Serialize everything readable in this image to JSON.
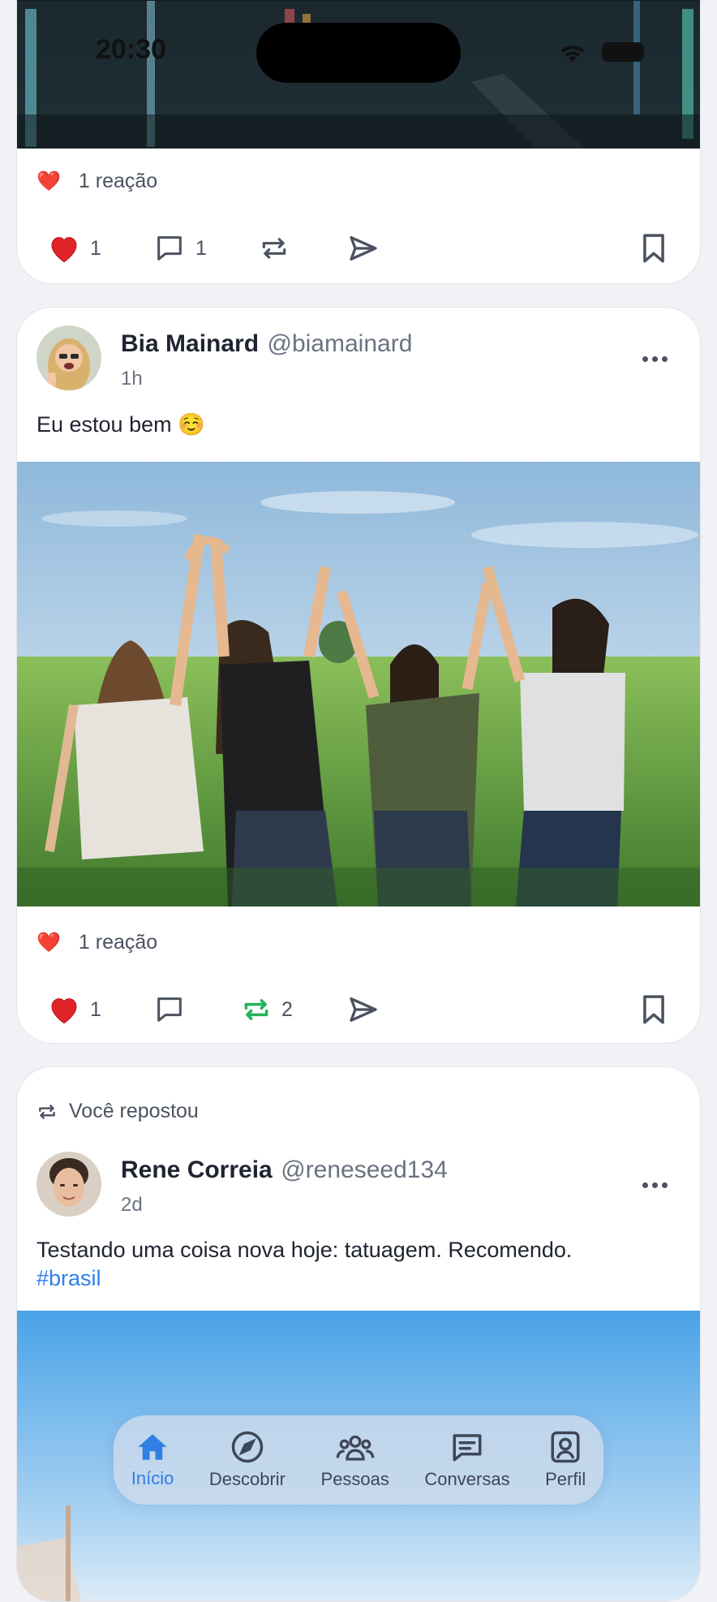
{
  "status_bar": {
    "time": "20:30"
  },
  "posts": [
    {
      "reaction_emoji": "❤️",
      "reaction_summary": "1 reação",
      "likes": "1",
      "comments": "1",
      "reposts": "",
      "reposted_active": false
    },
    {
      "author_name": "Bia Mainard",
      "author_handle": "@biamainard",
      "time": "1h",
      "text": "Eu estou bem ☺️",
      "reaction_emoji": "❤️",
      "reaction_summary": "1 reação",
      "likes": "1",
      "comments": "",
      "reposts": "2",
      "reposted_active": true
    },
    {
      "repost_label": "Você repostou",
      "author_name": "Rene Correia",
      "author_handle": "@reneseed134",
      "time": "2d",
      "text": "Testando uma coisa nova hoje: tatuagem. Recomendo.",
      "hashtag": "#brasil"
    }
  ],
  "tabbar": {
    "items": [
      {
        "label": "Início",
        "icon": "home-icon",
        "active": true
      },
      {
        "label": "Descobrir",
        "icon": "compass-icon",
        "active": false
      },
      {
        "label": "Pessoas",
        "icon": "people-icon",
        "active": false
      },
      {
        "label": "Conversas",
        "icon": "chat-icon",
        "active": false
      },
      {
        "label": "Perfil",
        "icon": "profile-icon",
        "active": false
      }
    ]
  },
  "colors": {
    "accent": "#2f7fe4",
    "repost_active": "#22b35a",
    "like": "#e0242a",
    "hashtag": "#2f80ed"
  }
}
